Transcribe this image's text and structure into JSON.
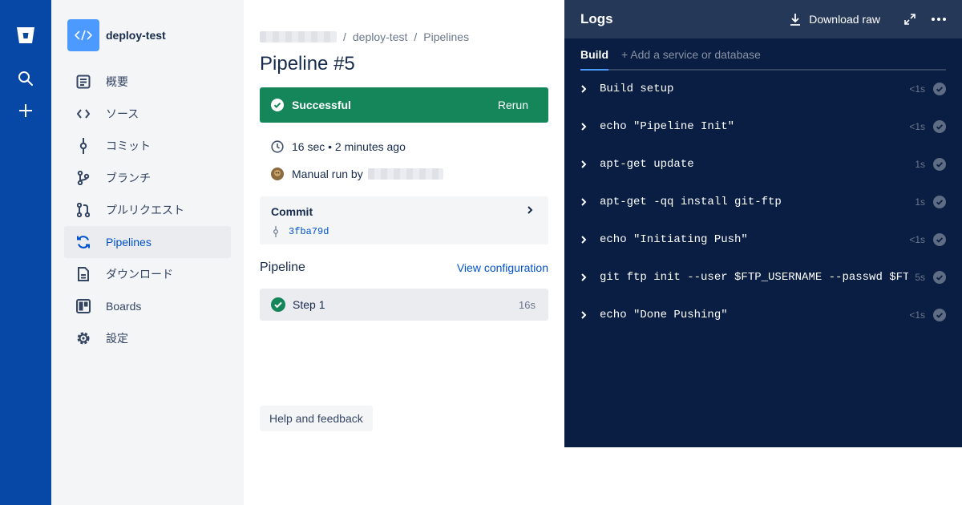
{
  "breadcrumb": {
    "workspace": "",
    "repo": "deploy-test",
    "section": "Pipelines",
    "sep1": "/",
    "sep2": "/"
  },
  "project": {
    "name": "deploy-test"
  },
  "sidebar": {
    "items": [
      {
        "label": "概要",
        "icon": "overview-icon"
      },
      {
        "label": "ソース",
        "icon": "source-icon"
      },
      {
        "label": "コミット",
        "icon": "commit-icon"
      },
      {
        "label": "ブランチ",
        "icon": "branch-icon"
      },
      {
        "label": "プルリクエスト",
        "icon": "pull-request-icon"
      },
      {
        "label": "Pipelines",
        "icon": "pipelines-icon",
        "active": true
      },
      {
        "label": "ダウンロード",
        "icon": "download-icon"
      },
      {
        "label": "Boards",
        "icon": "boards-icon"
      },
      {
        "label": "設定",
        "icon": "settings-icon"
      }
    ]
  },
  "pipeline": {
    "title": "Pipeline #5",
    "status": "Successful",
    "rerun": "Rerun",
    "duration": "16 sec • 2 minutes ago",
    "trigger": "Manual run by",
    "commit_label": "Commit",
    "commit_hash": "3fba79d",
    "section_title": "Pipeline",
    "view_config": "View configuration",
    "steps": [
      {
        "name": "Step 1",
        "duration": "16s"
      }
    ]
  },
  "help": {
    "label": "Help and feedback"
  },
  "logs": {
    "title": "Logs",
    "download": "Download raw",
    "tab_build": "Build",
    "tab_add": "+ Add a service or database",
    "rows": [
      {
        "cmd": "Build setup",
        "time": "<1s"
      },
      {
        "cmd": "echo \"Pipeline Init\"",
        "time": "<1s"
      },
      {
        "cmd": "apt-get update",
        "time": "1s"
      },
      {
        "cmd": "apt-get -qq install git-ftp",
        "time": "1s"
      },
      {
        "cmd": "echo \"Initiating Push\"",
        "time": "<1s"
      },
      {
        "cmd": "git ftp init --user $FTP_USERNAME --passwd $FTP_PASSW",
        "time": "5s"
      },
      {
        "cmd": "echo \"Done Pushing\"",
        "time": "<1s"
      }
    ]
  },
  "colors": {
    "nav": "#0747A6",
    "success": "#14865A",
    "logs_bg": "#091E42",
    "link": "#0052CC"
  }
}
